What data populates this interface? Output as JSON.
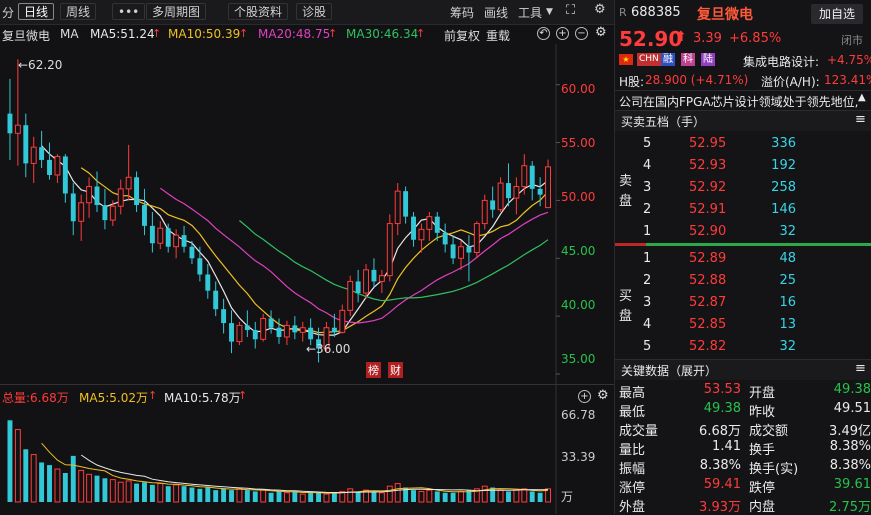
{
  "toolbar": {
    "left_item": "分",
    "daily": "日线",
    "weekly": "周线",
    "more": "•••",
    "multi": "多周期图",
    "profile": "个股资料",
    "diag": "诊股",
    "chips": "筹码",
    "draw": "画线",
    "tools": "工具"
  },
  "maline": {
    "name": "复旦微电",
    "ma": "MA",
    "ma5": "MA5:51.24",
    "ma10": "MA10:50.39",
    "ma20": "MA20:48.75",
    "ma30": "MA30:46.34",
    "fq": "前复权",
    "overlay": "重载"
  },
  "price_axis": [
    "60.00",
    "55.00",
    "50.00",
    "45.00",
    "40.00",
    "35.00"
  ],
  "annotations": {
    "high": "←62.20",
    "low": "←36.00",
    "tag1": "榜",
    "tag2": "财"
  },
  "volume": {
    "total": "总量:6.68万",
    "ma5": "MA5:5.02万",
    "ma10": "MA10:5.78万",
    "axis_top": "66.78",
    "axis_mid": "33.39",
    "unit": "万"
  },
  "stock": {
    "r": "R",
    "code": "688385",
    "name": "复旦微电",
    "add": "加自选",
    "price": "52.90",
    "change": "3.39",
    "pct": "+6.85%",
    "status": "闭市",
    "badges": [
      "CHN",
      "融",
      "科",
      "陆"
    ],
    "sector": "集成电路设计:",
    "sector_pct": "+4.75%",
    "h_label": "H股:",
    "h_value": "28.900 (+4.71%)",
    "premium_label": "溢价(A/H):",
    "premium_value": "123.41%",
    "desc": "公司在国内FPGA芯片设计领域处于领先地位,"
  },
  "orderbook": {
    "title": "买卖五档（手）",
    "sell_label": [
      "卖",
      "盘"
    ],
    "buy_label": [
      "买",
      "盘"
    ],
    "sells": [
      {
        "lvl": "5",
        "price": "52.95",
        "vol": "336"
      },
      {
        "lvl": "4",
        "price": "52.93",
        "vol": "192"
      },
      {
        "lvl": "3",
        "price": "52.92",
        "vol": "258"
      },
      {
        "lvl": "2",
        "price": "52.91",
        "vol": "146"
      },
      {
        "lvl": "1",
        "price": "52.90",
        "vol": "32"
      }
    ],
    "buys": [
      {
        "lvl": "1",
        "price": "52.89",
        "vol": "48"
      },
      {
        "lvl": "2",
        "price": "52.88",
        "vol": "25"
      },
      {
        "lvl": "3",
        "price": "52.87",
        "vol": "16"
      },
      {
        "lvl": "4",
        "price": "52.85",
        "vol": "13"
      },
      {
        "lvl": "5",
        "price": "52.82",
        "vol": "32"
      }
    ]
  },
  "keydata": {
    "title": "关键数据（展开）",
    "rows": [
      {
        "l1": "最高",
        "v1": "53.53",
        "l2": "开盘",
        "v2": "49.38"
      },
      {
        "l1": "最低",
        "v1": "49.38",
        "l2": "昨收",
        "v2": "49.51"
      },
      {
        "l1": "成交量",
        "v1": "6.68万",
        "l2": "成交额",
        "v2": "3.49亿"
      },
      {
        "l1": "量比",
        "v1": "1.41",
        "l2": "换手",
        "v2": "8.38%"
      },
      {
        "l1": "振幅",
        "v1": "8.38%",
        "l2": "换手(实)",
        "v2": "8.38%"
      },
      {
        "l1": "涨停",
        "v1": "59.41",
        "l2": "跌停",
        "v2": "39.61"
      },
      {
        "l1": "外盘",
        "v1": "3.93万",
        "l2": "内盘",
        "v2": "2.75万"
      }
    ]
  },
  "colors": {
    "up": "#ff3b3b",
    "down": "#27c24c",
    "ma5": "#e8e8e8",
    "ma10": "#f0c020",
    "ma20": "#e040c0",
    "ma30": "#30c060",
    "ma60": "#4080e0",
    "bg": "#121214"
  },
  "chart_data": {
    "type": "candlestick",
    "ylim": [
      35,
      63
    ],
    "candles": [
      {
        "o": 57.5,
        "h": 60.5,
        "l": 53.5,
        "c": 55.8
      },
      {
        "o": 55.8,
        "h": 62.2,
        "l": 53.0,
        "c": 56.5
      },
      {
        "o": 56.5,
        "h": 57.5,
        "l": 52.0,
        "c": 53.2
      },
      {
        "o": 53.2,
        "h": 55.5,
        "l": 51.5,
        "c": 54.6
      },
      {
        "o": 54.6,
        "h": 56.0,
        "l": 52.8,
        "c": 53.5
      },
      {
        "o": 53.5,
        "h": 55.0,
        "l": 51.8,
        "c": 52.2
      },
      {
        "o": 52.2,
        "h": 54.0,
        "l": 51.5,
        "c": 53.8
      },
      {
        "o": 53.8,
        "h": 54.0,
        "l": 49.8,
        "c": 50.6
      },
      {
        "o": 50.6,
        "h": 51.5,
        "l": 47.0,
        "c": 48.2
      },
      {
        "o": 48.2,
        "h": 50.5,
        "l": 46.5,
        "c": 49.8
      },
      {
        "o": 49.8,
        "h": 52.0,
        "l": 48.5,
        "c": 51.2
      },
      {
        "o": 51.2,
        "h": 52.5,
        "l": 49.0,
        "c": 49.6
      },
      {
        "o": 49.6,
        "h": 51.0,
        "l": 47.5,
        "c": 48.3
      },
      {
        "o": 48.3,
        "h": 50.0,
        "l": 47.8,
        "c": 49.5
      },
      {
        "o": 49.5,
        "h": 51.8,
        "l": 48.8,
        "c": 51.0
      },
      {
        "o": 51.0,
        "h": 54.8,
        "l": 50.0,
        "c": 52.0
      },
      {
        "o": 52.0,
        "h": 52.5,
        "l": 49.0,
        "c": 49.6
      },
      {
        "o": 49.6,
        "h": 51.0,
        "l": 47.0,
        "c": 47.8
      },
      {
        "o": 47.8,
        "h": 49.0,
        "l": 45.5,
        "c": 46.3
      },
      {
        "o": 46.3,
        "h": 48.2,
        "l": 45.8,
        "c": 47.6
      },
      {
        "o": 47.6,
        "h": 48.0,
        "l": 45.5,
        "c": 46.0
      },
      {
        "o": 46.0,
        "h": 47.5,
        "l": 45.0,
        "c": 47.0
      },
      {
        "o": 47.0,
        "h": 47.8,
        "l": 45.5,
        "c": 46.0
      },
      {
        "o": 46.0,
        "h": 46.5,
        "l": 44.5,
        "c": 45.0
      },
      {
        "o": 45.0,
        "h": 46.0,
        "l": 43.0,
        "c": 43.6
      },
      {
        "o": 43.6,
        "h": 44.5,
        "l": 41.5,
        "c": 42.2
      },
      {
        "o": 42.2,
        "h": 43.0,
        "l": 40.0,
        "c": 40.6
      },
      {
        "o": 40.6,
        "h": 41.5,
        "l": 38.5,
        "c": 39.4
      },
      {
        "o": 39.4,
        "h": 40.5,
        "l": 36.8,
        "c": 37.8
      },
      {
        "o": 37.8,
        "h": 39.5,
        "l": 37.5,
        "c": 39.2
      },
      {
        "o": 39.2,
        "h": 40.5,
        "l": 38.2,
        "c": 38.8
      },
      {
        "o": 38.8,
        "h": 39.5,
        "l": 37.2,
        "c": 38.0
      },
      {
        "o": 38.0,
        "h": 40.2,
        "l": 37.8,
        "c": 39.8
      },
      {
        "o": 39.8,
        "h": 40.5,
        "l": 38.5,
        "c": 39.0
      },
      {
        "o": 39.0,
        "h": 39.8,
        "l": 37.6,
        "c": 38.2
      },
      {
        "o": 38.2,
        "h": 39.6,
        "l": 37.5,
        "c": 39.2
      },
      {
        "o": 39.2,
        "h": 40.0,
        "l": 38.0,
        "c": 38.6
      },
      {
        "o": 38.6,
        "h": 39.5,
        "l": 37.8,
        "c": 39.0
      },
      {
        "o": 39.0,
        "h": 39.8,
        "l": 37.5,
        "c": 38.0
      },
      {
        "o": 38.0,
        "h": 39.0,
        "l": 36.0,
        "c": 37.2
      },
      {
        "o": 37.2,
        "h": 39.5,
        "l": 37.0,
        "c": 39.0
      },
      {
        "o": 39.0,
        "h": 40.2,
        "l": 38.2,
        "c": 38.6
      },
      {
        "o": 38.6,
        "h": 41.0,
        "l": 38.5,
        "c": 40.5
      },
      {
        "o": 40.5,
        "h": 43.5,
        "l": 40.0,
        "c": 43.0
      },
      {
        "o": 43.0,
        "h": 44.0,
        "l": 41.2,
        "c": 42.0
      },
      {
        "o": 42.0,
        "h": 44.5,
        "l": 41.5,
        "c": 44.0
      },
      {
        "o": 44.0,
        "h": 45.0,
        "l": 42.5,
        "c": 43.0
      },
      {
        "o": 43.0,
        "h": 44.0,
        "l": 42.0,
        "c": 43.5
      },
      {
        "o": 43.5,
        "h": 48.8,
        "l": 43.0,
        "c": 48.0
      },
      {
        "o": 48.0,
        "h": 51.5,
        "l": 47.0,
        "c": 50.8
      },
      {
        "o": 50.8,
        "h": 51.2,
        "l": 48.0,
        "c": 48.6
      },
      {
        "o": 48.6,
        "h": 49.0,
        "l": 46.0,
        "c": 46.6
      },
      {
        "o": 46.6,
        "h": 48.0,
        "l": 45.5,
        "c": 47.5
      },
      {
        "o": 47.5,
        "h": 49.0,
        "l": 46.5,
        "c": 48.6
      },
      {
        "o": 48.6,
        "h": 49.0,
        "l": 46.5,
        "c": 47.2
      },
      {
        "o": 47.2,
        "h": 48.0,
        "l": 45.5,
        "c": 46.2
      },
      {
        "o": 46.2,
        "h": 47.0,
        "l": 44.5,
        "c": 45.0
      },
      {
        "o": 45.0,
        "h": 46.5,
        "l": 44.0,
        "c": 46.0
      },
      {
        "o": 46.0,
        "h": 47.0,
        "l": 43.0,
        "c": 45.5
      },
      {
        "o": 45.5,
        "h": 48.2,
        "l": 45.0,
        "c": 48.0
      },
      {
        "o": 48.0,
        "h": 50.5,
        "l": 47.5,
        "c": 50.0
      },
      {
        "o": 50.0,
        "h": 51.2,
        "l": 48.5,
        "c": 49.2
      },
      {
        "o": 49.2,
        "h": 52.0,
        "l": 49.0,
        "c": 51.5
      },
      {
        "o": 51.5,
        "h": 53.2,
        "l": 49.5,
        "c": 50.2
      },
      {
        "o": 50.2,
        "h": 52.0,
        "l": 48.8,
        "c": 51.2
      },
      {
        "o": 51.2,
        "h": 54.0,
        "l": 50.5,
        "c": 53.0
      },
      {
        "o": 53.0,
        "h": 53.4,
        "l": 50.0,
        "c": 51.0
      },
      {
        "o": 51.0,
        "h": 52.0,
        "l": 49.5,
        "c": 50.5
      },
      {
        "o": 49.38,
        "h": 53.53,
        "l": 49.38,
        "c": 52.9
      }
    ],
    "volume": [
      62,
      55,
      40,
      36,
      30,
      28,
      25,
      22,
      35,
      24,
      21,
      20,
      18,
      17,
      15,
      16,
      14,
      15,
      13,
      14,
      12,
      13,
      12,
      11,
      10,
      11,
      9,
      10,
      9,
      10,
      9,
      8,
      9,
      7,
      8,
      7,
      8,
      6,
      7,
      7,
      6,
      7,
      8,
      10,
      8,
      9,
      8,
      7,
      12,
      14,
      11,
      9,
      8,
      9,
      8,
      7,
      7,
      8,
      9,
      10,
      12,
      11,
      9,
      8,
      9,
      10,
      8,
      7,
      10
    ]
  }
}
